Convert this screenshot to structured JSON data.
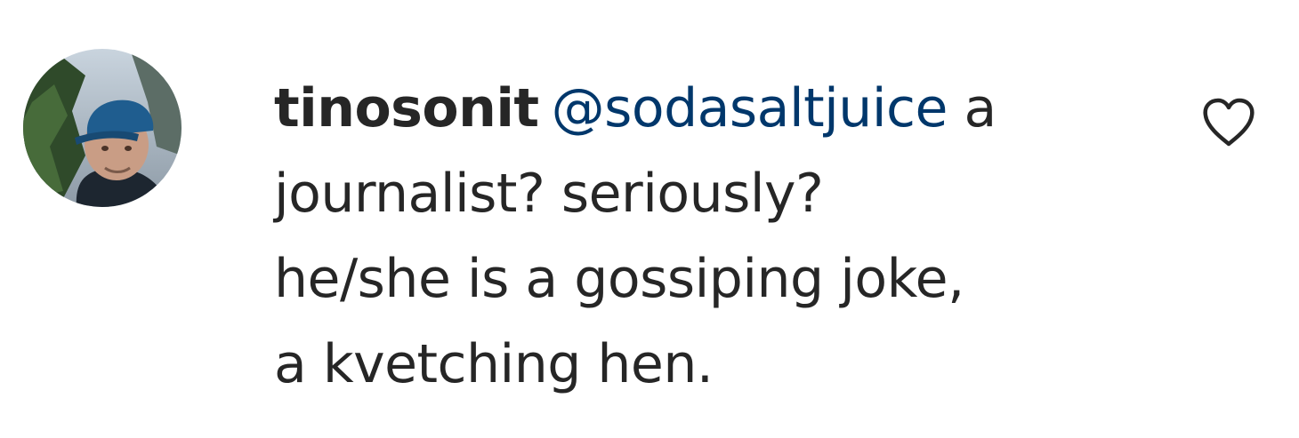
{
  "comment": {
    "username": "tinosonit",
    "mention": "@sodasaltjuice",
    "text_lines": [
      " a",
      "journalist? seriously?",
      "he/she is a gossiping joke,",
      "a kvetching hen."
    ],
    "avatar_icon": "profile-photo",
    "like_icon": "heart-outline-icon"
  },
  "colors": {
    "text": "#262626",
    "mention": "#00376b",
    "background": "#ffffff"
  }
}
